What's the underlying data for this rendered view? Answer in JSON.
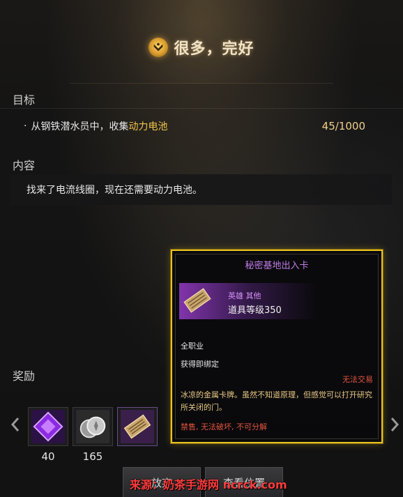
{
  "header": {
    "title": "很多，完好",
    "icon": "quest-emblem-icon"
  },
  "objective": {
    "label": "目标",
    "bullet": "·",
    "text_prefix": "从钢铁潜水员中，收集",
    "text_highlight": "动力电池",
    "progress": "45/1000"
  },
  "content": {
    "label": "内容",
    "text": "找来了电流线圈，现在还需要动力电池。"
  },
  "rewards": {
    "label": "奖励",
    "items": [
      {
        "icon": "purple-crystal-icon",
        "count": "40"
      },
      {
        "icon": "silver-coins-icon",
        "count": "165"
      },
      {
        "icon": "access-card-icon",
        "count": ""
      }
    ]
  },
  "buttons": {
    "abandon": "放弃",
    "view_location": "查看位置"
  },
  "tooltip": {
    "title": "秘密基地出入卡",
    "grade": "英雄 其他",
    "item_level": "道具等级350",
    "class": "全职业",
    "bind": "获得即绑定",
    "untradeable": "无法交易",
    "description": "冰凉的金属卡牌。虽然不知道原理，但感觉可以打开研究所关闭的门。",
    "restrictions": "禁售, 无法破坏, 不可分解"
  },
  "watermark": "来源：奶茶手游网 ncrck.com",
  "colors": {
    "accent_gold": "#f2c44a",
    "tooltip_border": "#e9c21f",
    "hero_purple": "#c27be8",
    "warning_red": "#e3533e"
  }
}
